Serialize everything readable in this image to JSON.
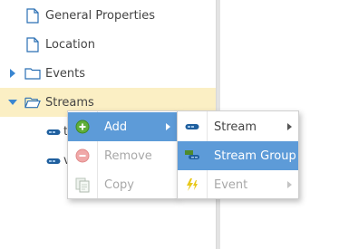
{
  "tree": {
    "items": [
      {
        "label": "General Properties",
        "icon": "document-icon"
      },
      {
        "label": "Location",
        "icon": "document-icon"
      },
      {
        "label": "Events",
        "icon": "folder-icon",
        "expander": "collapsed"
      },
      {
        "label": "Streams",
        "icon": "folder-open-icon",
        "expander": "expanded",
        "selected": true
      }
    ],
    "children": [
      {
        "text": "t",
        "icon": "stream-icon"
      },
      {
        "text": "v",
        "icon": "stream-icon"
      }
    ]
  },
  "context_menu": {
    "items": [
      {
        "label": "Add",
        "icon": "add-icon",
        "state": "hover",
        "has_submenu": true
      },
      {
        "label": "Remove",
        "icon": "remove-icon",
        "state": "disabled"
      },
      {
        "label": "Copy",
        "icon": "copy-icon",
        "state": "disabled"
      }
    ]
  },
  "submenu": {
    "items": [
      {
        "label": "Stream",
        "icon": "stream-icon",
        "state": "normal",
        "has_submenu": true
      },
      {
        "label": "Stream Group",
        "icon": "stream-group-icon",
        "state": "hover"
      },
      {
        "label": "Event",
        "icon": "event-icon",
        "state": "disabled",
        "has_submenu": true
      }
    ]
  },
  "colors": {
    "selection": "#fbefc4",
    "menu_hover": "#5d9bd8",
    "icon_blue": "#1f5f9e",
    "add_green": "#5fae3b",
    "remove_red": "#e06666",
    "event_yellow": "#e8c81a"
  }
}
